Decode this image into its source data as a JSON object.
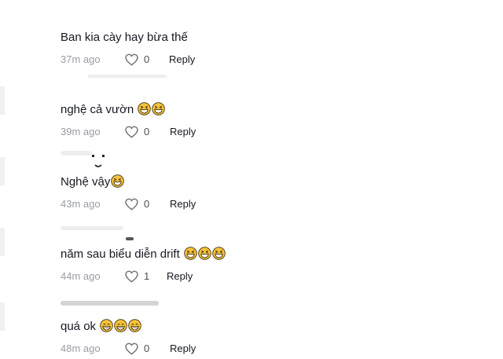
{
  "comments": [
    {
      "text": "Ban kia cày hay bừa thế",
      "emoji_count": 0,
      "emoji": "grin-squint",
      "time": "37m ago",
      "likes": "0",
      "reply_label": "Reply"
    },
    {
      "text": "nghệ cả vườn",
      "emoji_count": 2,
      "emoji": "grin-squint",
      "time": "39m ago",
      "likes": "0",
      "reply_label": "Reply"
    },
    {
      "text": "Nghệ vậy",
      "emoji_count": 1,
      "emoji": "grin-squint",
      "time": "43m ago",
      "likes": "0",
      "reply_label": "Reply"
    },
    {
      "text": "năm sau biểu diễn drift",
      "emoji_count": 3,
      "emoji": "grin-squint",
      "time": "44m ago",
      "likes": "1",
      "reply_label": "Reply"
    },
    {
      "text": "quá ok",
      "emoji_count": 3,
      "emoji": "grin-beam",
      "time": "48m ago",
      "likes": "0",
      "reply_label": "Reply"
    }
  ],
  "colors": {
    "text": "#161823",
    "muted": "#9a9ca3",
    "emoji_face": "#f5c33b",
    "emoji_outline": "#3d2e12"
  }
}
